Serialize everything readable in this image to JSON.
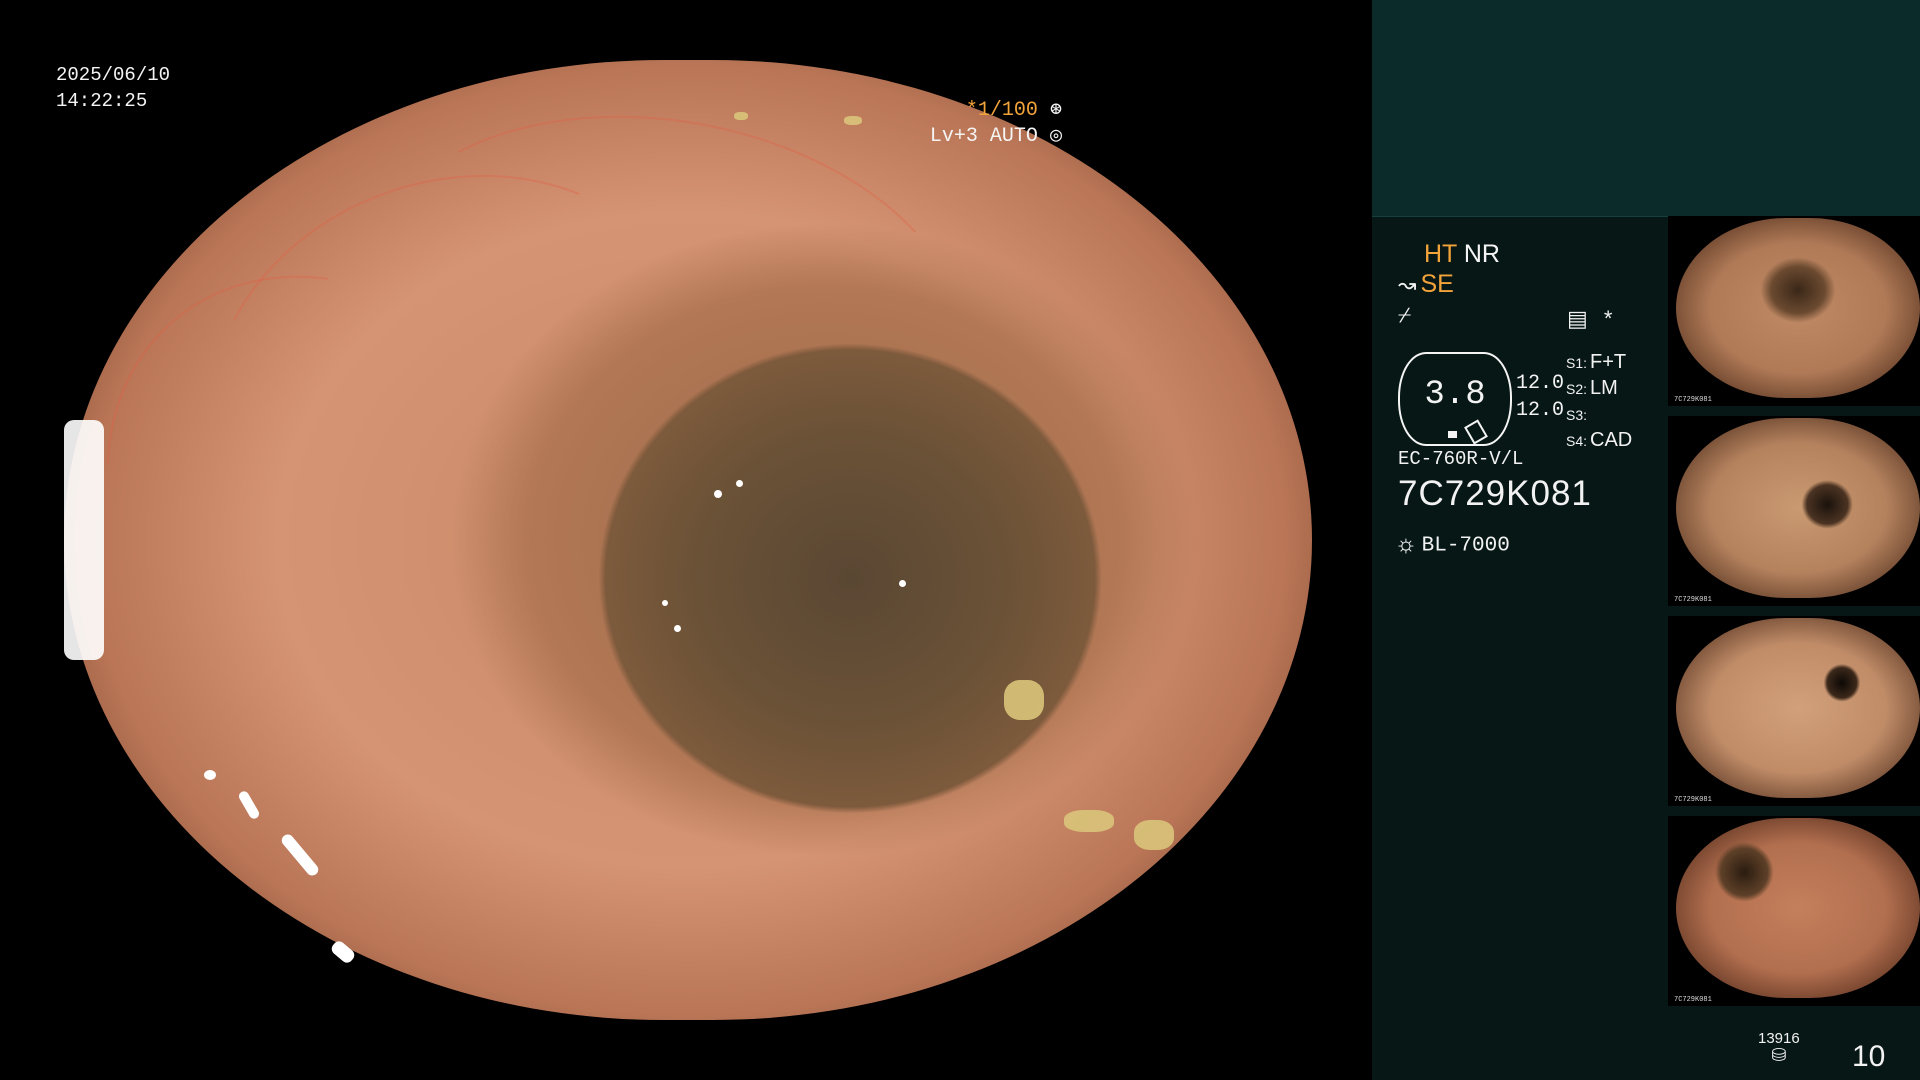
{
  "overlay": {
    "date": "2025/06/10",
    "time": "14:22:25",
    "shutter_prefix": "*",
    "shutter": "1/100",
    "shutter_icon": "aperture-icon",
    "level": "Lv+3",
    "mode": "AUTO",
    "mode_icon": "iris-icon"
  },
  "processor": {
    "ht": "HT",
    "nr": "NR",
    "se": "SE",
    "se_icon": "tilde-icon",
    "enhance_icon": "slash-icon",
    "settings_icon": "menu-box-icon",
    "star": "*"
  },
  "lens": {
    "value": "3.8",
    "val1": "12.0",
    "val2": "12.0"
  },
  "switches": [
    {
      "label": "S1:",
      "value": "F+T"
    },
    {
      "label": "S2:",
      "value": "LM"
    },
    {
      "label": "S3:",
      "value": ""
    },
    {
      "label": "S4:",
      "value": "CAD"
    }
  ],
  "scope": {
    "model": "EC-760R-V/L",
    "serial": "7C729K081"
  },
  "light_source": {
    "icon": "sun-icon",
    "name": "BL-7000"
  },
  "thumbnails": [
    {
      "id_label": "7C729K081"
    },
    {
      "id_label": "7C729K081"
    },
    {
      "id_label": "7C729K081"
    },
    {
      "id_label": "7C729K081"
    }
  ],
  "storage": {
    "count": "13916",
    "icon": "database-icon"
  },
  "image_counter": "10",
  "colors": {
    "accent": "#f2a33a",
    "panel": "#071716",
    "panel_top": "#0b2b2a"
  }
}
